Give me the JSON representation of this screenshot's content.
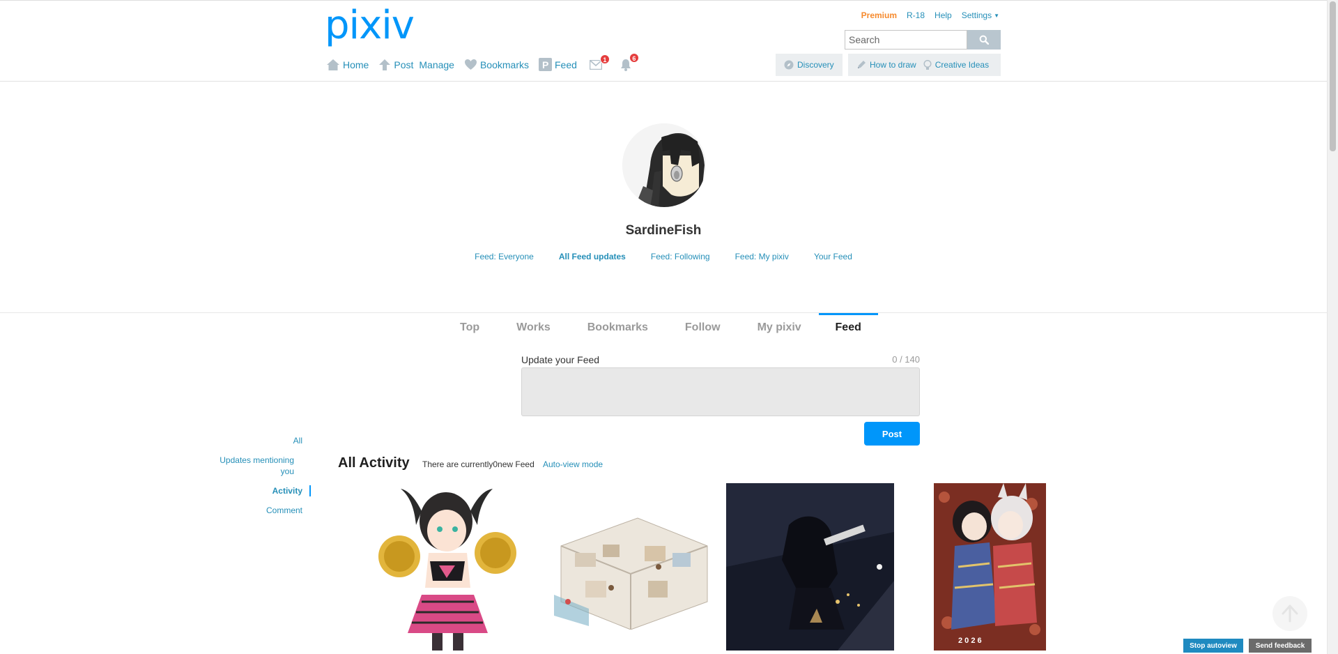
{
  "header": {
    "logo": "pixiv",
    "toplinks": {
      "premium": "Premium",
      "r18": "R-18",
      "help": "Help",
      "settings": "Settings"
    },
    "search": {
      "placeholder": "Search",
      "value": ""
    },
    "nav": {
      "home": "Home",
      "post": "Post",
      "manage": "Manage",
      "bookmarks": "Bookmarks",
      "feed": "Feed",
      "messages_badge": "1",
      "notifications_badge": "6"
    },
    "subnav": {
      "discovery": "Discovery",
      "how_to_draw": "How to draw",
      "creative_ideas": "Creative Ideas"
    }
  },
  "profile": {
    "username": "SardineFish",
    "feed_links": [
      "Feed: Everyone",
      "All Feed updates",
      "Feed: Following",
      "Feed: My pixiv",
      "Your Feed"
    ]
  },
  "tabs": [
    "Top",
    "Works",
    "Bookmarks",
    "Follow",
    "My pixiv",
    "Feed"
  ],
  "composer": {
    "label": "Update your Feed",
    "count": "0 / 140",
    "post_label": "Post"
  },
  "sidemenu": [
    "All",
    "Updates mentioning you",
    "Activity",
    "Comment"
  ],
  "activity": {
    "title": "All Activity",
    "count_text": "There are currently0new Feed",
    "auto_view": "Auto-view mode"
  },
  "thumbnail_overlay": "2 0 2 6",
  "footer_buttons": {
    "stop_autoview": "Stop autoview",
    "send_feedback": "Send feedback"
  },
  "colors": {
    "brand": "#0096fa",
    "link": "#258fb8",
    "premium": "#f68a2d",
    "badge": "#e53d3d"
  }
}
